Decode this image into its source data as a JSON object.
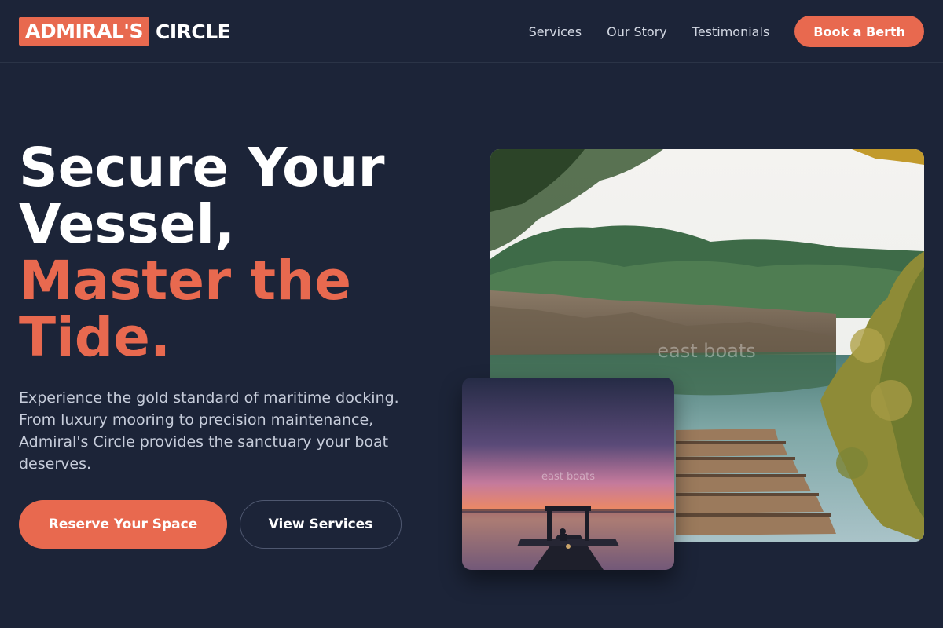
{
  "header": {
    "logo_mark": "ADMIRAL'S",
    "logo_word": "CIRCLE",
    "nav": [
      {
        "label": "Services"
      },
      {
        "label": "Our Story"
      },
      {
        "label": "Testimonials"
      }
    ],
    "cta_label": "Book a Berth"
  },
  "hero": {
    "title_line1": "Secure Your",
    "title_line2": "Vessel,",
    "title_accent1": "Master the",
    "title_accent2": "Tide.",
    "description": "Experience the gold standard of maritime docking. From luxury mooring to precision maintenance, Admiral's Circle provides the sanctuary your boat deserves.",
    "primary_button": "Reserve Your Space",
    "secondary_button": "View Services"
  },
  "images": {
    "main_watermark": "east boats",
    "small_watermark": "east boats"
  },
  "colors": {
    "background": "#1c2438",
    "accent": "#e8694f",
    "text_muted": "#c6ccda"
  }
}
